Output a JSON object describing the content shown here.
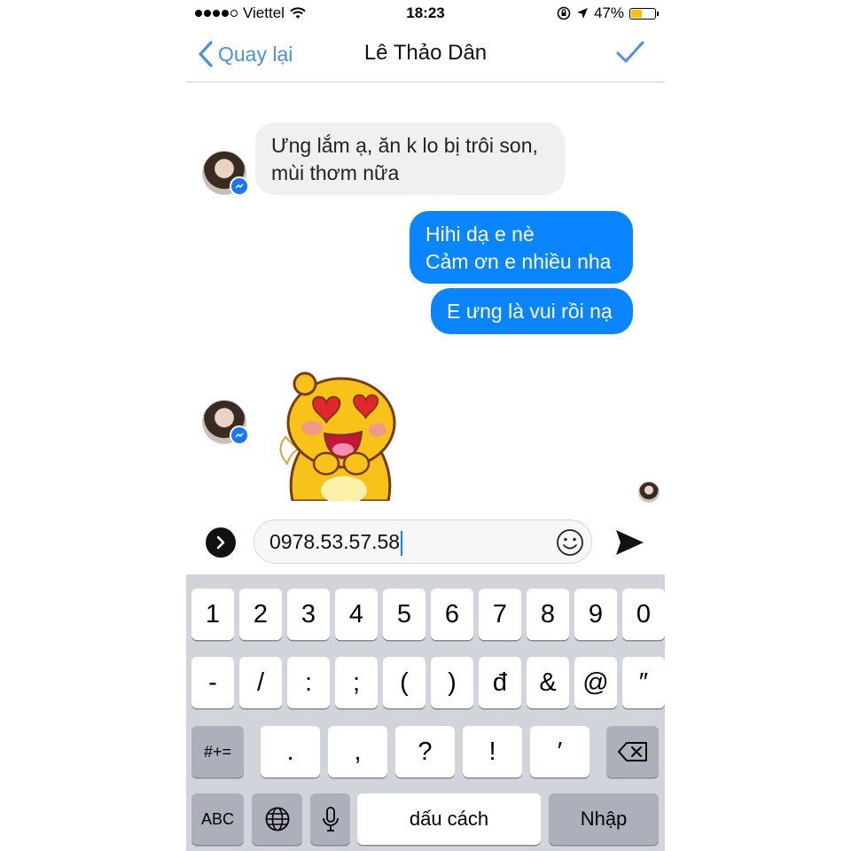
{
  "status_bar": {
    "carrier": "Viettel",
    "time": "18:23",
    "battery": "47%",
    "battery_level": 0.47
  },
  "nav": {
    "back_label": "Quay lại",
    "title": "Lê Thảo Dân"
  },
  "messages": {
    "incoming_1": [
      "Ưng lắm ạ, ăn k lo bị trôi son,",
      "mùi thơm nữa"
    ],
    "outgoing_1": [
      "Hihi dạ e nè",
      "Cảm ơn e nhiều nha"
    ],
    "outgoing_2": [
      "E ưng là vui rồi nạ"
    ]
  },
  "composer": {
    "value": "0978.53.57.58"
  },
  "keyboard": {
    "row1": [
      "1",
      "2",
      "3",
      "4",
      "5",
      "6",
      "7",
      "8",
      "9",
      "0"
    ],
    "row2": [
      "-",
      "/",
      ":",
      ";",
      "(",
      ")",
      "đ",
      "&",
      "@",
      "″"
    ],
    "row3_symbols_key": "#+=",
    "row3": [
      ".",
      ",",
      "?",
      "!",
      "′"
    ],
    "abc_key": "ABC",
    "space_key": "dấu cách",
    "return_key": "Nhập"
  },
  "colors": {
    "accent": "#4a90e2",
    "outgoing_bubble": "#0a84ff",
    "incoming_bubble": "#f0f0f0",
    "keyboard_bg": "#d1d4da"
  }
}
